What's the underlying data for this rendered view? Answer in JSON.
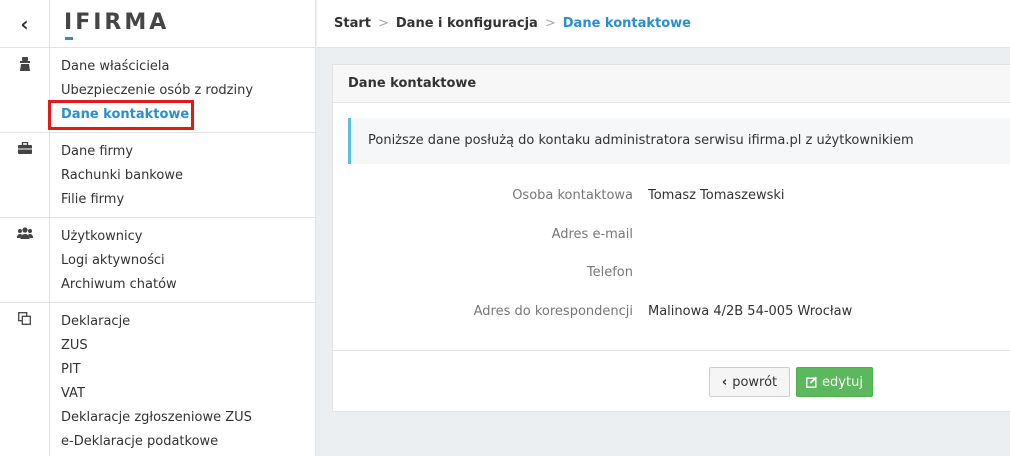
{
  "logo": {
    "first": "I",
    "rest": "FIRMA"
  },
  "sidebar": {
    "back_icon": "chevron-left",
    "groups": [
      {
        "icon": "owner-icon",
        "items": [
          "Dane właściciela",
          "Ubezpieczenie osób z rodziny",
          "Dane kontaktowe"
        ],
        "active": 2
      },
      {
        "icon": "briefcase-icon",
        "items": [
          "Dane firmy",
          "Rachunki bankowe",
          "Filie firmy"
        ]
      },
      {
        "icon": "users-icon",
        "items": [
          "Użytkownicy",
          "Logi aktywności",
          "Archiwum chatów"
        ]
      },
      {
        "icon": "copy-icon",
        "items": [
          "Deklaracje",
          "ZUS",
          "PIT",
          "VAT",
          "Deklaracje zgłoszeniowe ZUS",
          "e-Deklaracje podatkowe"
        ]
      }
    ]
  },
  "breadcrumb": {
    "items": [
      "Start",
      "Dane i konfiguracja",
      "Dane kontaktowe"
    ],
    "separator": ">"
  },
  "panel": {
    "title": "Dane kontaktowe",
    "info": "Poniższe dane posłużą do kontaku administratora serwisu ifirma.pl z użytkownikiem",
    "fields": [
      {
        "label": "Osoba kontaktowa",
        "value": "Tomasz Tomaszewski"
      },
      {
        "label": "Adres e-mail",
        "value": ""
      },
      {
        "label": "Telefon",
        "value": ""
      },
      {
        "label": "Adres do korespondencji",
        "value": "Malinowa 4/2B 54-005 Wrocław"
      }
    ],
    "back_label": "powrót",
    "edit_label": "edytuj"
  },
  "colors": {
    "accent": "#2b8ed0",
    "highlight": "#e11a1a",
    "success": "#5cb85c",
    "info_border": "#5bc0de"
  }
}
